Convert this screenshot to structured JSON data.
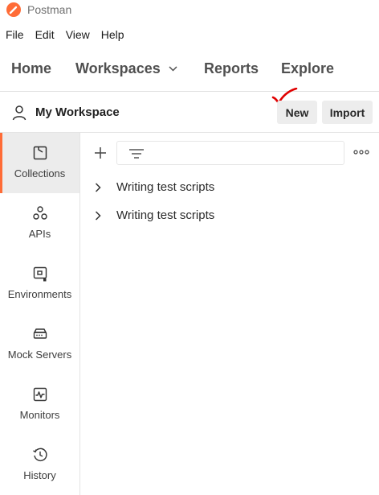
{
  "window": {
    "title": "Postman"
  },
  "menu": [
    "File",
    "Edit",
    "View",
    "Help"
  ],
  "nav": {
    "home": "Home",
    "workspaces": "Workspaces",
    "reports": "Reports",
    "explore": "Explore"
  },
  "workspace": {
    "name": "My Workspace",
    "new_label": "New",
    "import_label": "Import"
  },
  "sidebar": {
    "items": [
      {
        "label": "Collections",
        "icon": "collections-icon",
        "active": true
      },
      {
        "label": "APIs",
        "icon": "apis-icon",
        "active": false
      },
      {
        "label": "Environments",
        "icon": "environments-icon",
        "active": false
      },
      {
        "label": "Mock Servers",
        "icon": "mock-servers-icon",
        "active": false
      },
      {
        "label": "Monitors",
        "icon": "monitors-icon",
        "active": false
      },
      {
        "label": "History",
        "icon": "history-icon",
        "active": false
      }
    ]
  },
  "collections": [
    {
      "name": "Writing test scripts"
    },
    {
      "name": "Writing test scripts"
    }
  ],
  "colors": {
    "accent": "#ff6c37",
    "annotation": "#e00000",
    "active_bg": "#ececec"
  }
}
